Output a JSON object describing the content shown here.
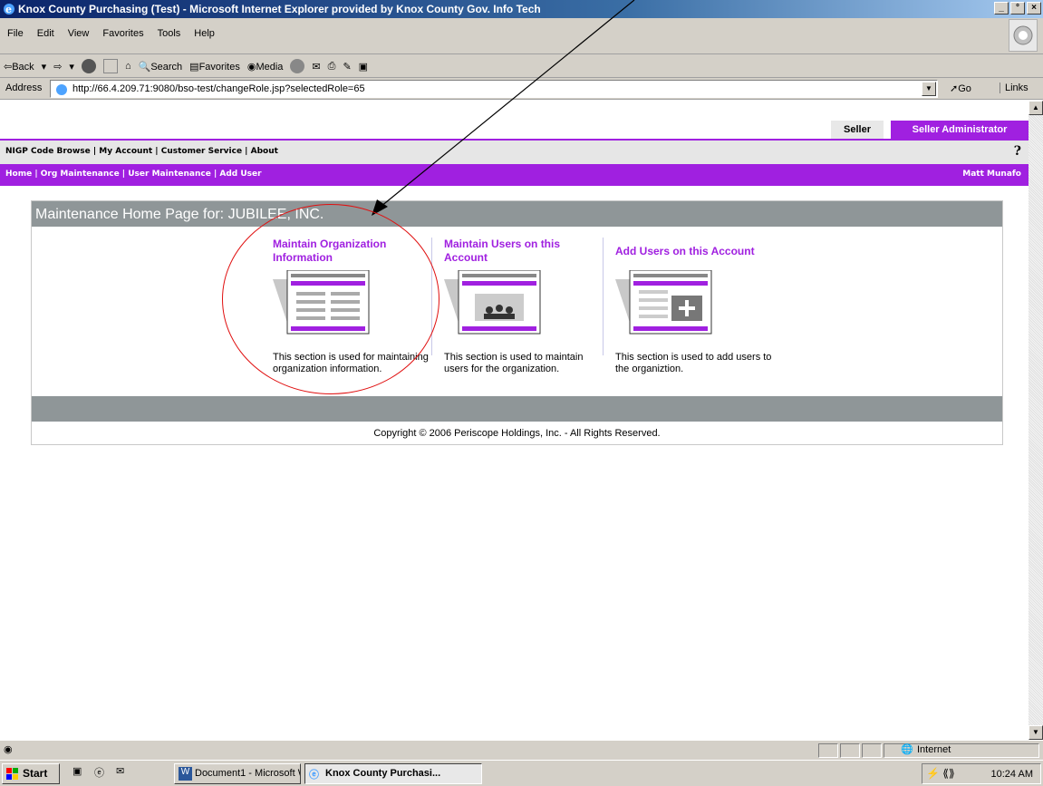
{
  "window": {
    "title": "Knox County Purchasing (Test) - Microsoft Internet Explorer provided by Knox County Gov. Info Tech",
    "controls": [
      "_",
      "°",
      "×"
    ]
  },
  "menu": [
    "File",
    "Edit",
    "View",
    "Favorites",
    "Tools",
    "Help"
  ],
  "toolbar": {
    "back": "⇦Back",
    "search": "Search",
    "favorites": "Favorites",
    "media": "Media"
  },
  "address": {
    "label": "Address",
    "url": "http://66.4.209.71:9080/bso-test/changeRole.jsp?selectedRole=65",
    "go": "Go",
    "links": "Links"
  },
  "role_tabs": {
    "seller": "Seller",
    "admin": "Seller Administrator"
  },
  "nav_top": {
    "links": "NIGP Code Browse | My Account | Customer Service | About",
    "help": "?"
  },
  "nav_purple": {
    "links": "Home | Org Maintenance | User Maintenance | Add User",
    "user": "Matt Munafo"
  },
  "panel": {
    "heading": "Maintenance Home Page for: JUBILEE, INC.",
    "cards": [
      {
        "title": "Maintain Organization Information",
        "desc": "This section is used for maintaining organization information."
      },
      {
        "title": "Maintain Users on this Account",
        "desc": "This section is used to maintain users for the organization."
      },
      {
        "title": "Add Users on this Account",
        "desc": "This section is used to add users to the organiztion."
      }
    ],
    "copyright": "Copyright © 2006 Periscope Holdings, Inc. - All Rights Reserved."
  },
  "status": {
    "zone": "Internet"
  },
  "taskbar": {
    "start": "Start",
    "tasks": [
      "Document1 - Microsoft W...",
      "Knox County Purchasi..."
    ],
    "clock": "10:24 AM"
  },
  "colors": {
    "purple": "#a020e0",
    "gray_bar": "#8f9698",
    "annotation_red": "#e01010"
  }
}
